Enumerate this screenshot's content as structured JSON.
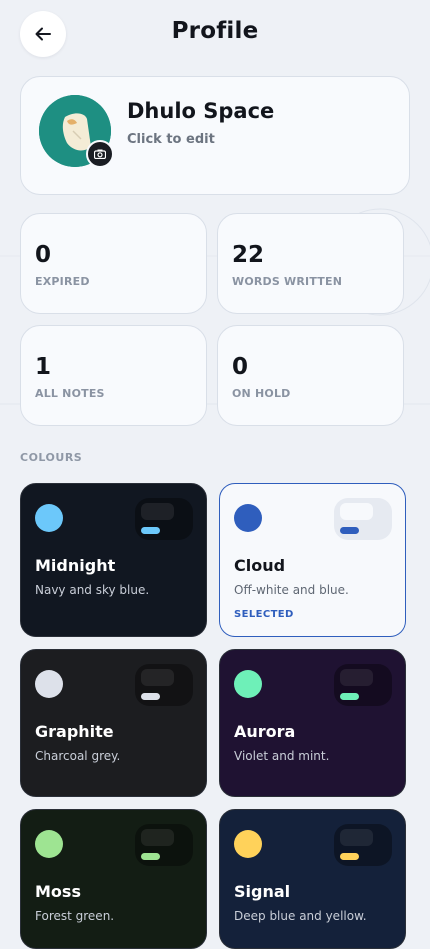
{
  "header": {
    "title": "Profile"
  },
  "profile": {
    "name": "Dhulo Space",
    "hint": "Click to edit"
  },
  "stats": [
    {
      "value": "0",
      "label": "EXPIRED"
    },
    {
      "value": "22",
      "label": "WORDS WRITTEN"
    },
    {
      "value": "1",
      "label": "ALL NOTES"
    },
    {
      "value": "0",
      "label": "ON HOLD"
    }
  ],
  "colours": {
    "section_label": "COLOURS",
    "themes": [
      {
        "name": "Midnight",
        "description": "Navy and sky blue.",
        "status": "",
        "bg": "#111721",
        "accent": "#6cc8fa"
      },
      {
        "name": "Cloud",
        "description": "Off-white and blue.",
        "status": "SELECTED",
        "bg": "#f7f9fc",
        "accent": "#2f5ebd"
      },
      {
        "name": "Graphite",
        "description": "Charcoal grey.",
        "status": "",
        "bg": "#1c1d20",
        "accent": "#dde1ea"
      },
      {
        "name": "Aurora",
        "description": "Violet and mint.",
        "status": "",
        "bg": "#1f1232",
        "accent": "#6ef0b8"
      },
      {
        "name": "Moss",
        "description": "Forest green.",
        "status": "",
        "bg": "#131d14",
        "accent": "#9ee492"
      },
      {
        "name": "Signal",
        "description": "Deep blue and yellow.",
        "status": "",
        "bg": "#14213a",
        "accent": "#ffd25a"
      }
    ]
  }
}
